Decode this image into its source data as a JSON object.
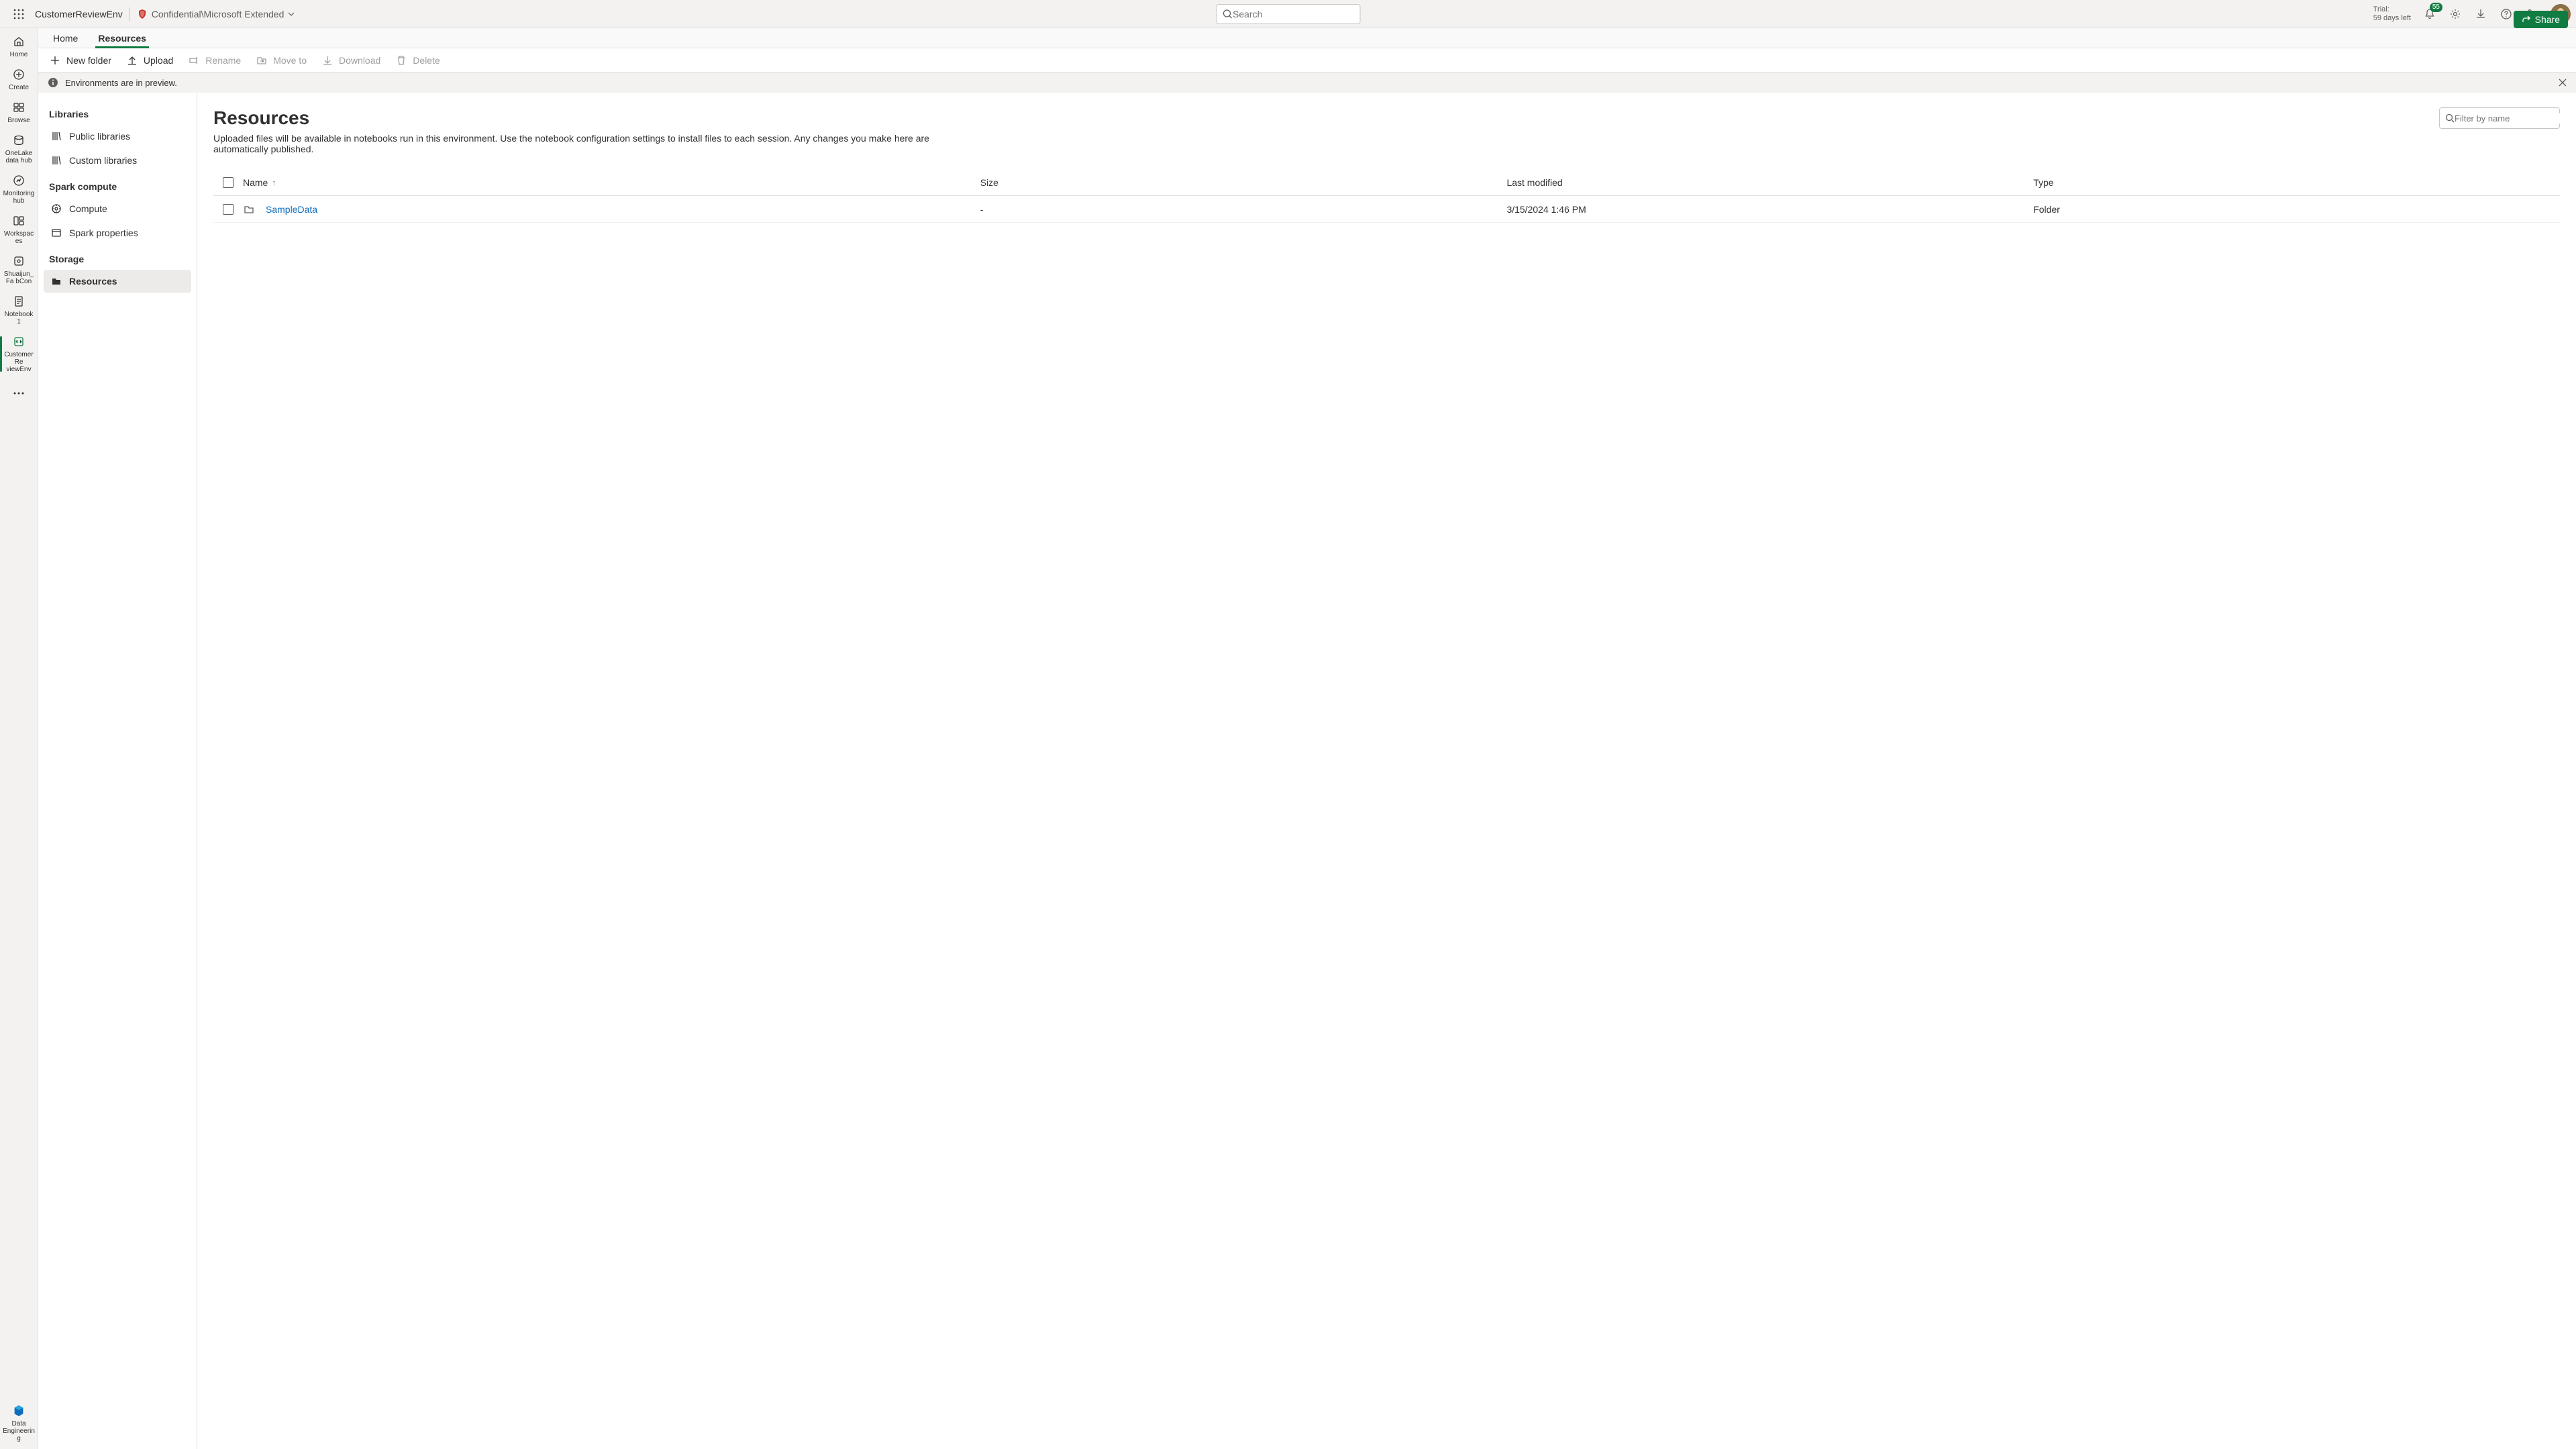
{
  "topbar": {
    "breadcrumb_title": "CustomerReviewEnv",
    "classification_label": "Confidential\\Microsoft Extended",
    "search_placeholder": "Search",
    "trial_label": "Trial:",
    "trial_days": "59 days left",
    "notification_count": "55"
  },
  "tabs": {
    "home": "Home",
    "resources": "Resources",
    "share": "Share"
  },
  "toolbar": {
    "new_folder": "New folder",
    "upload": "Upload",
    "rename": "Rename",
    "move_to": "Move to",
    "download": "Download",
    "delete": "Delete"
  },
  "banner": {
    "text": "Environments are in preview."
  },
  "rail": [
    {
      "label": "Home"
    },
    {
      "label": "Create"
    },
    {
      "label": "Browse"
    },
    {
      "label": "OneLake data hub"
    },
    {
      "label": "Monitoring hub"
    },
    {
      "label": "Workspaces"
    },
    {
      "label": "Shuaijun_Fa bCon"
    },
    {
      "label": "Notebook 1"
    },
    {
      "label": "CustomerRe viewEnv"
    }
  ],
  "rail_bottom": {
    "label": "Data Engineering"
  },
  "sidebar": {
    "section_libraries": "Libraries",
    "public_libraries": "Public libraries",
    "custom_libraries": "Custom libraries",
    "section_spark": "Spark compute",
    "compute": "Compute",
    "spark_properties": "Spark properties",
    "section_storage": "Storage",
    "resources": "Resources"
  },
  "content": {
    "title": "Resources",
    "subtitle": "Uploaded files will be available in notebooks run in this environment. Use the notebook configuration settings to install files to each session. Any changes you make here are automatically published.",
    "filter_placeholder": "Filter by name"
  },
  "table": {
    "columns": {
      "name": "Name",
      "size": "Size",
      "last_modified": "Last modified",
      "type": "Type"
    },
    "rows": [
      {
        "name": "SampleData",
        "size": "-",
        "last_modified": "3/15/2024 1:46 PM",
        "type": "Folder"
      }
    ]
  }
}
